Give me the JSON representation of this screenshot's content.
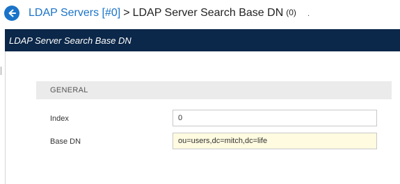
{
  "breadcrumb": {
    "back_icon": "arrow-left-circle-icon",
    "parent_link": "LDAP Servers [#0]",
    "separator": ">",
    "current": "LDAP Server Search Base DN",
    "count": "(0)",
    "trailing": "."
  },
  "panel": {
    "title": "LDAP Server Search Base DN"
  },
  "section": {
    "title": "GENERAL"
  },
  "fields": {
    "index": {
      "label": "Index",
      "value": "0"
    },
    "base_dn": {
      "label": "Base DN",
      "value": "ou=users,dc=mitch,dc=life"
    }
  },
  "colors": {
    "link": "#1a73c8",
    "panel_header": "#0b2749",
    "section_bg": "#ebebeb",
    "highlight_field": "#fffbe0"
  }
}
